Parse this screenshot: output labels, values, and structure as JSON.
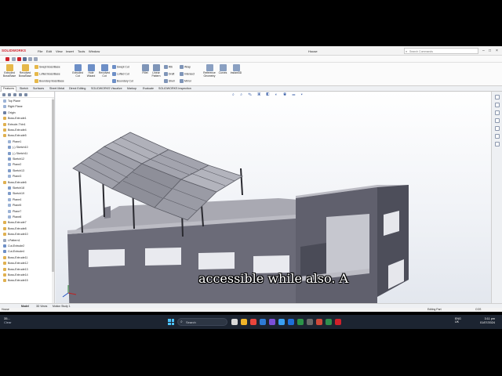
{
  "app": {
    "logo": "SOLIDWORKS",
    "menus": [
      "File",
      "Edit",
      "View",
      "Insert",
      "Tools",
      "Window"
    ],
    "document_title": "House",
    "search_placeholder": "Search Commands"
  },
  "ribbon": {
    "large_buttons": [
      {
        "label1": "Extruded",
        "label2": "Boss/Base",
        "icon": "extrude-boss-icon"
      },
      {
        "label1": "Revolved",
        "label2": "Boss/Base",
        "icon": "revolve-boss-icon"
      },
      {
        "label1": "Extruded",
        "label2": "Cut",
        "icon": "extrude-cut-icon"
      },
      {
        "label1": "Hole",
        "label2": "Wizard",
        "icon": "hole-wizard-icon"
      },
      {
        "label1": "Revolved",
        "label2": "Cut",
        "icon": "revolve-cut-icon"
      },
      {
        "label1": "Fillet",
        "label2": "",
        "icon": "fillet-icon"
      },
      {
        "label1": "Linear",
        "label2": "Pattern",
        "icon": "linear-pattern-icon"
      },
      {
        "label1": "Reference",
        "label2": "Geometry",
        "icon": "reference-geometry-icon"
      },
      {
        "label1": "Curves",
        "label2": "",
        "icon": "curves-icon"
      },
      {
        "label1": "Instant3D",
        "label2": "",
        "icon": "instant3d-icon"
      }
    ],
    "small_buttons": [
      {
        "label": "Swept Boss/Base",
        "icon": "swept-boss-icon"
      },
      {
        "label": "Lofted Boss/Base",
        "icon": "lofted-boss-icon"
      },
      {
        "label": "Boundary Boss/Base",
        "icon": "boundary-boss-icon"
      },
      {
        "label": "Swept Cut",
        "icon": "swept-cut-icon"
      },
      {
        "label": "Lofted Cut",
        "icon": "lofted-cut-icon"
      },
      {
        "label": "Boundary Cut",
        "icon": "boundary-cut-icon"
      },
      {
        "label": "Rib",
        "icon": "rib-icon"
      },
      {
        "label": "Draft",
        "icon": "draft-icon"
      },
      {
        "label": "Shell",
        "icon": "shell-icon"
      },
      {
        "label": "Wrap",
        "icon": "wrap-icon"
      },
      {
        "label": "Intersect",
        "icon": "intersect-icon"
      },
      {
        "label": "Mirror",
        "icon": "mirror-icon"
      }
    ]
  },
  "tabs": [
    {
      "label": "Features",
      "active": true
    },
    {
      "label": "Sketch",
      "active": false
    },
    {
      "label": "Surfaces",
      "active": false
    },
    {
      "label": "Sheet Metal",
      "active": false
    },
    {
      "label": "Direct Editing",
      "active": false
    },
    {
      "label": "SOLIDWORKS Visualize",
      "active": false
    },
    {
      "label": "Markup",
      "active": false
    },
    {
      "label": "Evaluate",
      "active": false
    },
    {
      "label": "SOLIDWORKS Inspection",
      "active": false
    }
  ],
  "tree": {
    "items": [
      {
        "label": "Top Plane",
        "icon": "plane-icon",
        "indent": 0
      },
      {
        "label": "Right Plane",
        "icon": "plane-icon",
        "indent": 0
      },
      {
        "label": "Origin",
        "icon": "origin-icon",
        "indent": 0
      },
      {
        "label": "Boss-Extrude1",
        "icon": "extrude-icon",
        "indent": 0
      },
      {
        "label": "Extrude-Thin1",
        "icon": "extrude-icon",
        "indent": 0
      },
      {
        "label": "Boss-Extrude4",
        "icon": "extrude-icon",
        "indent": 0
      },
      {
        "label": "Boss-Extrude5",
        "icon": "extrude-icon",
        "indent": 0
      },
      {
        "label": "Plane1",
        "icon": "plane-icon",
        "indent": 1
      },
      {
        "label": "(-) Sketch10",
        "icon": "sketch-icon",
        "indent": 1
      },
      {
        "label": "(-) Sketch11",
        "icon": "sketch-icon",
        "indent": 1
      },
      {
        "label": "Sketch12",
        "icon": "sketch-icon",
        "indent": 1
      },
      {
        "label": "Plane2",
        "icon": "plane-icon",
        "indent": 1
      },
      {
        "label": "Sketch13",
        "icon": "sketch-icon",
        "indent": 1
      },
      {
        "label": "Plane3",
        "icon": "plane-icon",
        "indent": 1
      },
      {
        "label": "Boss-Extrude6",
        "icon": "extrude-icon",
        "indent": 0
      },
      {
        "label": "Sketch18",
        "icon": "sketch-icon",
        "indent": 1
      },
      {
        "label": "Sketch19",
        "icon": "sketch-icon",
        "indent": 1
      },
      {
        "label": "Plane4",
        "icon": "plane-icon",
        "indent": 1
      },
      {
        "label": "Plane5",
        "icon": "plane-icon",
        "indent": 1
      },
      {
        "label": "Plane7",
        "icon": "plane-icon",
        "indent": 1
      },
      {
        "label": "Plane8",
        "icon": "plane-icon",
        "indent": 1
      },
      {
        "label": "Boss-Extrude7",
        "icon": "extrude-icon",
        "indent": 0
      },
      {
        "label": "Boss-Extrude8",
        "icon": "extrude-icon",
        "indent": 0
      },
      {
        "label": "Boss-Extrude10",
        "icon": "extrude-icon",
        "indent": 0
      },
      {
        "label": "LPattern1",
        "icon": "pattern-icon",
        "indent": 0
      },
      {
        "label": "Cut-Extrude2",
        "icon": "cut-icon",
        "indent": 0
      },
      {
        "label": "Cut-Extrude4",
        "icon": "cut-icon",
        "indent": 0
      },
      {
        "label": "Boss-Extrude11",
        "icon": "extrude-icon",
        "indent": 0
      },
      {
        "label": "Boss-Extrude12",
        "icon": "extrude-icon",
        "indent": 0
      },
      {
        "label": "Boss-Extrude13",
        "icon": "extrude-icon",
        "indent": 0
      },
      {
        "label": "Boss-Extrude14",
        "icon": "extrude-icon",
        "indent": 0
      },
      {
        "label": "Boss-Extrude15",
        "icon": "extrude-icon",
        "indent": 0
      }
    ]
  },
  "viewport": {
    "caption": "accessible while also. A"
  },
  "bottom_tabs": [
    {
      "label": "Model",
      "active": true
    },
    {
      "label": "3D Views",
      "active": false
    },
    {
      "label": "Motion Study 1",
      "active": false
    }
  ],
  "status": {
    "left": "House",
    "mode": "Editing Part",
    "units": "CGS"
  },
  "taskbar": {
    "weather_temp": "35...",
    "weather_desc": "Clear",
    "search_label": "Search",
    "language1": "ENG",
    "language2": "UK",
    "time": "3:11 pm",
    "date": "01/07/2024"
  },
  "colors": {
    "wall": "#6b6b78",
    "wall_dark": "#4d4e5a",
    "wall_top": "#bcbcc4",
    "floor": "#a9a9b2",
    "solar_panel": "#9fa0aa",
    "accent": "#d0202a"
  }
}
